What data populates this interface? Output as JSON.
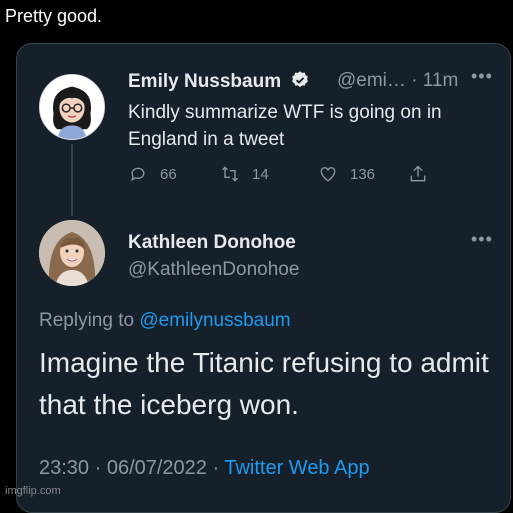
{
  "caption": "Pretty good.",
  "quoted_tweet": {
    "name": "Emily Nussbaum",
    "handle": "@emi…",
    "time": "· 11m",
    "text": "Kindly summarize WTF is going on in England in a tweet",
    "reply_count": "66",
    "retweet_count": "14",
    "like_count": "136"
  },
  "reply_tweet": {
    "name": "Kathleen Donohoe",
    "handle": "@KathleenDonohoe",
    "replying_to_prefix": "Replying to ",
    "replying_to_handle": "@emilynussbaum",
    "text": "Imagine the Titanic refusing to admit that the iceberg won.",
    "timestamp": "23:30 · 06/07/2022 · ",
    "app": "Twitter Web App"
  },
  "watermark": "imgflip.com",
  "colors": {
    "background": "#15202b",
    "link": "#1d9bf0",
    "muted": "#8b98a5",
    "verified": "#1d9bf0"
  }
}
